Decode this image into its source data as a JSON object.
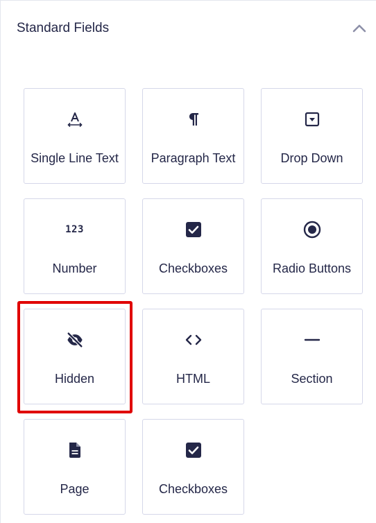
{
  "panel": {
    "title": "Standard Fields"
  },
  "fields": [
    {
      "label": "Single Line Text",
      "icon": "text-cursor-icon"
    },
    {
      "label": "Paragraph Text",
      "icon": "paragraph-icon"
    },
    {
      "label": "Drop Down",
      "icon": "dropdown-icon"
    },
    {
      "label": "Number",
      "icon": "number-icon",
      "icon_text": "123"
    },
    {
      "label": "Checkboxes",
      "icon": "checkbox-icon"
    },
    {
      "label": "Radio Buttons",
      "icon": "radio-icon"
    },
    {
      "label": "Hidden",
      "icon": "eye-slash-icon"
    },
    {
      "label": "HTML",
      "icon": "code-icon"
    },
    {
      "label": "Section",
      "icon": "minus-icon"
    },
    {
      "label": "Page",
      "icon": "page-icon"
    },
    {
      "label": "Checkboxes",
      "icon": "checkbox-icon"
    }
  ],
  "highlighted_field": "Hidden",
  "colors": {
    "text": "#242748",
    "border": "#d5d7e9",
    "highlight": "#e00000"
  }
}
